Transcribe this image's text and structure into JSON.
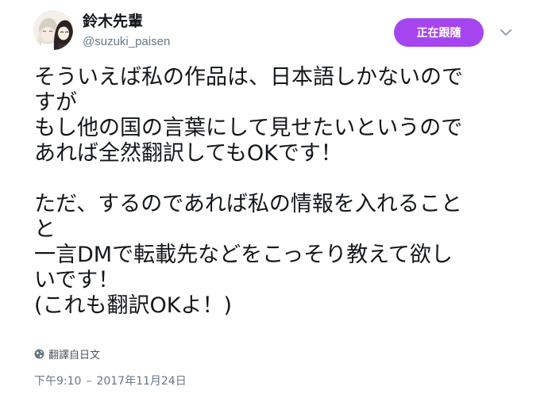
{
  "user": {
    "display_name": "鈴木先輩",
    "handle": "@suzuki_paisen"
  },
  "actions": {
    "follow_label": "正在跟隨",
    "more_icon": "chevron-down-icon"
  },
  "tweet": {
    "paragraph_1": [
      "そういえば私の作品は、日本語しかないので",
      "すが",
      "もし他の国の言葉にして見せたいというので",
      "あれば全然翻訳してもOKです！"
    ],
    "paragraph_2": [
      "ただ、するのであれば私の情報を入れること",
      "と",
      "一言DMで転載先などをこっそり教えて欲し",
      "いです！",
      "(これも翻訳OKよ！)"
    ]
  },
  "translate": {
    "icon": "globe-icon",
    "label": "翻譯自日文"
  },
  "meta": {
    "time": "下午9:10",
    "separator": "–",
    "date": "2017年11月24日"
  },
  "colors": {
    "accent": "#a545f0",
    "text_primary": "#14171a",
    "text_secondary": "#657786"
  }
}
